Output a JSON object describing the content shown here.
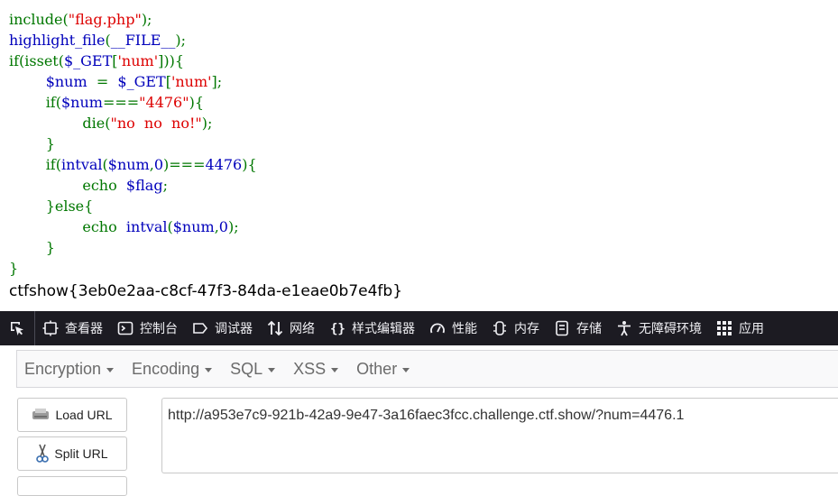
{
  "code_lines": [
    [
      {
        "t": "include(",
        "c": "k"
      },
      {
        "t": "\"flag.php\"",
        "c": "s"
      },
      {
        "t": ");",
        "c": "k"
      }
    ],
    [
      {
        "t": "highlight_file",
        "c": "d"
      },
      {
        "t": "(",
        "c": "k"
      },
      {
        "t": "__FILE__",
        "c": "d"
      },
      {
        "t": ");",
        "c": "k"
      }
    ],
    [
      {
        "t": "if(isset(",
        "c": "k"
      },
      {
        "t": "$_GET",
        "c": "d"
      },
      {
        "t": "[",
        "c": "k"
      },
      {
        "t": "'num'",
        "c": "s"
      },
      {
        "t": "])){",
        "c": "k"
      }
    ],
    [
      {
        "t": "        $num  ",
        "c": "d"
      },
      {
        "t": "=  ",
        "c": "k"
      },
      {
        "t": "$_GET",
        "c": "d"
      },
      {
        "t": "[",
        "c": "k"
      },
      {
        "t": "'num'",
        "c": "s"
      },
      {
        "t": "];",
        "c": "k"
      }
    ],
    [
      {
        "t": "        if(",
        "c": "k"
      },
      {
        "t": "$num",
        "c": "d"
      },
      {
        "t": "===",
        "c": "k"
      },
      {
        "t": "\"4476\"",
        "c": "s"
      },
      {
        "t": "){",
        "c": "k"
      }
    ],
    [
      {
        "t": "                die(",
        "c": "k"
      },
      {
        "t": "\"no  no  no!\"",
        "c": "s"
      },
      {
        "t": ");",
        "c": "k"
      }
    ],
    [
      {
        "t": "        }",
        "c": "k"
      }
    ],
    [
      {
        "t": "        if(",
        "c": "k"
      },
      {
        "t": "intval",
        "c": "d"
      },
      {
        "t": "(",
        "c": "k"
      },
      {
        "t": "$num",
        "c": "d"
      },
      {
        "t": ",",
        "c": "k"
      },
      {
        "t": "0",
        "c": "d"
      },
      {
        "t": ")===",
        "c": "k"
      },
      {
        "t": "4476",
        "c": "d"
      },
      {
        "t": "){",
        "c": "k"
      }
    ],
    [
      {
        "t": "                echo  ",
        "c": "k"
      },
      {
        "t": "$flag",
        "c": "d"
      },
      {
        "t": ";",
        "c": "k"
      }
    ],
    [
      {
        "t": "        }else{",
        "c": "k"
      }
    ],
    [
      {
        "t": "                echo  ",
        "c": "k"
      },
      {
        "t": "intval",
        "c": "d"
      },
      {
        "t": "(",
        "c": "k"
      },
      {
        "t": "$num",
        "c": "d"
      },
      {
        "t": ",",
        "c": "k"
      },
      {
        "t": "0",
        "c": "d"
      },
      {
        "t": ");",
        "c": "k"
      }
    ],
    [
      {
        "t": "        }",
        "c": "k"
      }
    ],
    [
      {
        "t": "}",
        "c": "k"
      }
    ]
  ],
  "output_text": "ctfshow{3eb0e2aa-c8cf-47f3-84da-e1eae0b7e4fb}",
  "devtools": {
    "tabs": [
      {
        "icon": "inspector-icon",
        "label": "查看器"
      },
      {
        "icon": "console-icon",
        "label": "控制台"
      },
      {
        "icon": "debugger-icon",
        "label": "调试器"
      },
      {
        "icon": "network-icon",
        "label": "网络"
      },
      {
        "icon": "style-editor-icon",
        "label": "样式编辑器"
      },
      {
        "icon": "performance-icon",
        "label": "性能"
      },
      {
        "icon": "memory-icon",
        "label": "内存"
      },
      {
        "icon": "storage-icon",
        "label": "存储"
      },
      {
        "icon": "accessibility-icon",
        "label": "无障碍环境"
      },
      {
        "icon": "applications-icon",
        "label": "应用"
      }
    ]
  },
  "hackbar": {
    "menus": [
      "Encryption",
      "Encoding",
      "SQL",
      "XSS",
      "Other"
    ],
    "load_url_label": "Load URL",
    "split_url_label": "Split URL",
    "url_value": "http://a953e7c9-921b-42a9-9e47-3a16faec3fcc.challenge.ctf.show/?num=4476.1"
  },
  "colors": {
    "php_keyword": "#007700",
    "php_default": "#0000BB",
    "php_string": "#DD0000",
    "devtools_bg": "#1c1b22"
  }
}
